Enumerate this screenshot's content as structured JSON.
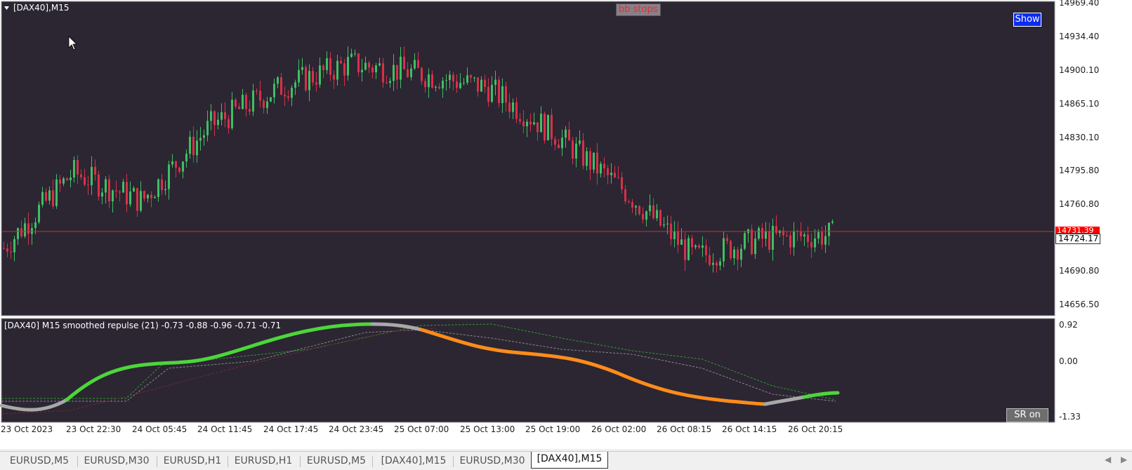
{
  "window": {
    "symbol_title": "[DAX40],M15"
  },
  "main_chart": {
    "price_labels": [
      "14969.40",
      "14934.40",
      "14900.10",
      "14865.10",
      "14830.10",
      "14795.80",
      "14760.80",
      "14690.80",
      "14656.50"
    ],
    "current_price_red": "14731.39",
    "current_price_white": "14724.17",
    "bb_stops_label": "bb stops",
    "show_button": "Show"
  },
  "indicator": {
    "title": "[DAX40] M15 smoothed repulse (21) -0.73 -0.88 -0.96 -0.71 -0.71",
    "scale_labels": [
      "0.92",
      "0.00",
      "-1.33"
    ],
    "sr_button": "SR on"
  },
  "time_axis": [
    "23 Oct 2023",
    "23 Oct 22:30",
    "24 Oct 05:45",
    "24 Oct 11:45",
    "24 Oct 17:45",
    "24 Oct 23:45",
    "25 Oct 07:00",
    "25 Oct 13:00",
    "25 Oct 19:00",
    "26 Oct 02:00",
    "26 Oct 08:15",
    "26 Oct 14:15",
    "26 Oct 20:15"
  ],
  "tabs": [
    {
      "label": "EURUSD,M5",
      "active": false
    },
    {
      "label": "EURUSD,M30",
      "active": false
    },
    {
      "label": "EURUSD,H1",
      "active": false
    },
    {
      "label": "EURUSD,H1",
      "active": false
    },
    {
      "label": "EURUSD,M5",
      "active": false
    },
    {
      "label": "[DAX40],M15",
      "active": false
    },
    {
      "label": "EURUSD,M30",
      "active": false
    },
    {
      "label": "[DAX40],M15",
      "active": true
    }
  ],
  "colors": {
    "chart_bg": "#2b2632",
    "bull": "#3fbf63",
    "bear": "#d8304a",
    "osc_up": "#4cd63a",
    "osc_down": "#ff8c1a",
    "osc_neutral": "#a8a8a8",
    "price_line": "#c83232"
  },
  "chart_data": {
    "type": "line",
    "x": [
      "23 Oct 2023",
      "23 Oct 22:30",
      "24 Oct 05:45",
      "24 Oct 11:45",
      "24 Oct 17:45",
      "24 Oct 23:45",
      "25 Oct 07:00",
      "25 Oct 13:00",
      "25 Oct 19:00",
      "26 Oct 02:00",
      "26 Oct 08:15",
      "26 Oct 14:15",
      "26 Oct 20:15"
    ],
    "series": [
      {
        "values": [
          14710,
          14790,
          14760,
          14840,
          14880,
          14905,
          14895,
          14880,
          14830,
          14770,
          14700,
          14720,
          14724
        ]
      }
    ],
    "ylim": [
      14640,
      14969.4
    ]
  }
}
